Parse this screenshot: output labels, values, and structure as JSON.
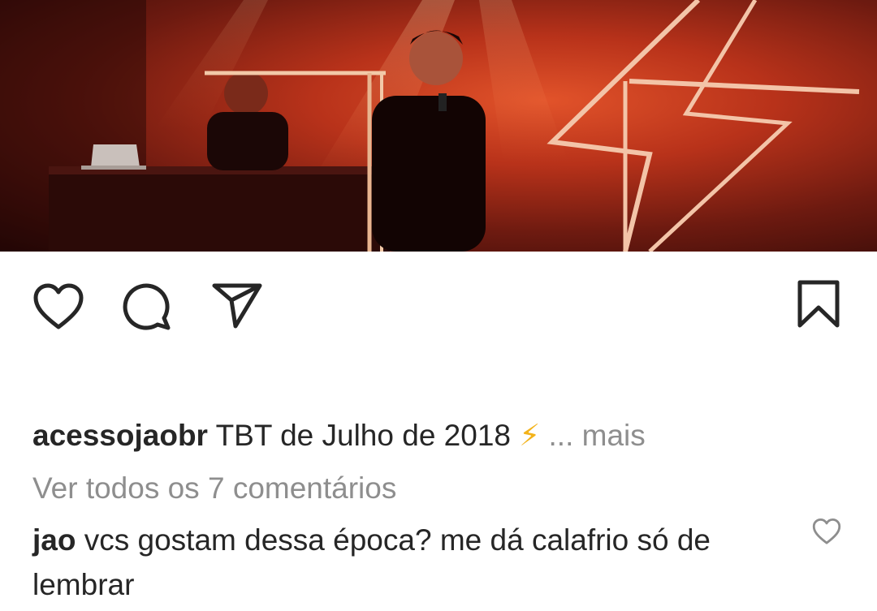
{
  "post": {
    "photo_alt": "Concert photo",
    "caption": {
      "username": "acessojaobr",
      "text": "TBT de Julho de 2018",
      "emoji": "⚡",
      "ellipsis": "...",
      "more_label": "mais"
    },
    "view_all_comments": "Ver todos os 7 comentários",
    "comments": [
      {
        "username": "jao",
        "text": "vcs gostam dessa época? me dá calafrio só de lembrar"
      }
    ]
  },
  "actions": {
    "like_icon": "heart-icon",
    "comment_icon": "comment-icon",
    "share_icon": "paper-plane-icon",
    "save_icon": "bookmark-icon"
  },
  "colors": {
    "text": "#262626",
    "secondary_text": "#8e8e8e",
    "bolt": "#f3b31b"
  }
}
